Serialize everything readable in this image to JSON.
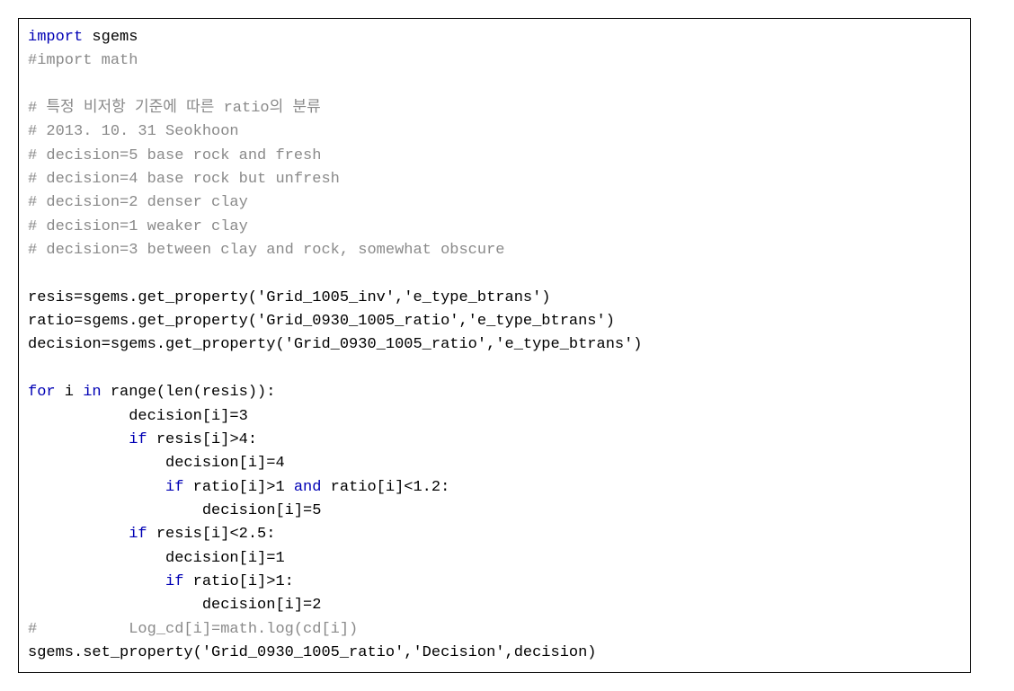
{
  "code": {
    "l1_kw1": "import",
    "l1_rest": " sgems",
    "l2": "#import math",
    "l3": "",
    "l4": "# 특정 비저항 기준에 따른 ratio의 분류",
    "l5": "# 2013. 10. 31 Seokhoon",
    "l6": "# decision=5 base rock and fresh",
    "l7": "# decision=4 base rock but unfresh",
    "l8": "# decision=2 denser clay",
    "l9": "# decision=1 weaker clay",
    "l10": "# decision=3 between clay and rock, somewhat obscure",
    "l11": "",
    "l12": "resis=sgems.get_property('Grid_1005_inv','e_type_btrans')",
    "l13": "ratio=sgems.get_property('Grid_0930_1005_ratio','e_type_btrans')",
    "l14": "decision=sgems.get_property('Grid_0930_1005_ratio','e_type_btrans')",
    "l15": "",
    "l16_kw1": "for",
    "l16_mid1": " i ",
    "l16_kw2": "in",
    "l16_mid2": " range(len(resis)):",
    "l17": "           decision[i]=3",
    "l18_pre": "           ",
    "l18_kw": "if",
    "l18_rest": " resis[i]>4:",
    "l19": "               decision[i]=4",
    "l20_pre": "               ",
    "l20_kw": "if",
    "l20_mid1": " ratio[i]>1 ",
    "l20_kw2": "and",
    "l20_rest": " ratio[i]<1.2:",
    "l21": "                   decision[i]=5",
    "l22_pre": "           ",
    "l22_kw": "if",
    "l22_rest": " resis[i]<2.5:",
    "l23": "               decision[i]=1",
    "l24_pre": "               ",
    "l24_kw": "if",
    "l24_rest": " ratio[i]>1:",
    "l25": "                   decision[i]=2",
    "l26": "#          Log_cd[i]=math.log(cd[i])",
    "l27": "sgems.set_property('Grid_0930_1005_ratio','Decision',decision)"
  }
}
